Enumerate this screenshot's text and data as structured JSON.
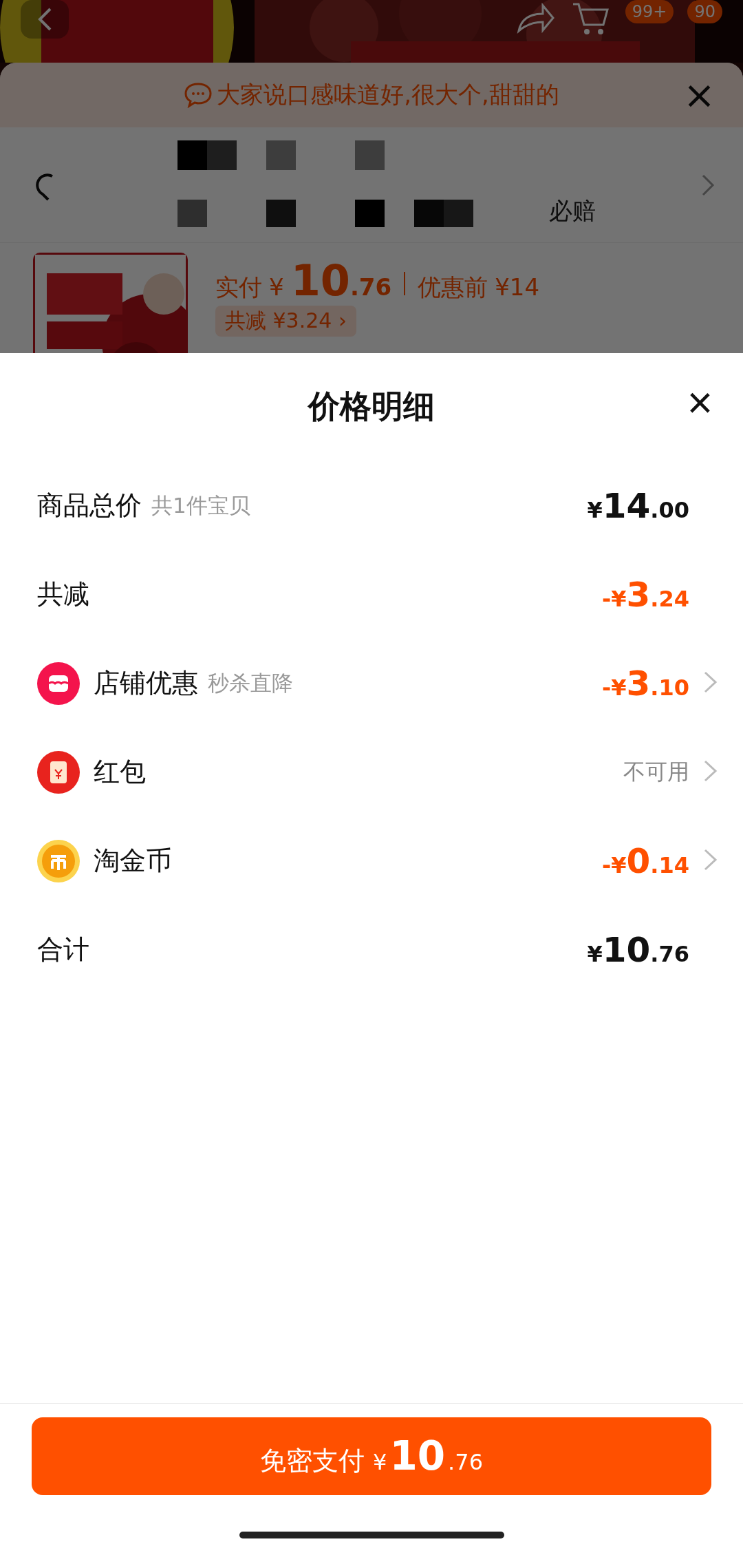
{
  "background_page": {
    "top_bar": {
      "cart_badge": "99+",
      "message_badge": "90"
    },
    "review_banner": {
      "text": "大家说口感味道好,很大个,甜甜的",
      "close": "×"
    },
    "address": {
      "note": "必赔"
    },
    "product": {
      "paid_label": "实付",
      "paid_symbol": "¥",
      "paid_int": "10",
      "paid_dec": ".76",
      "before_label": "优惠前",
      "before_price": "¥14",
      "discount_pill": "共减 ¥3.24 ›"
    }
  },
  "sheet": {
    "title": "价格明细",
    "close": "×",
    "rows": [
      {
        "kind": "plain",
        "label": "商品总价",
        "note": "共1件宝贝",
        "color": "#111111",
        "sign": "¥",
        "int": "14",
        "dec": ".00",
        "link": false
      },
      {
        "kind": "plain",
        "label": "共减",
        "color": "#ff5000",
        "sign": "-¥",
        "int": "3",
        "dec": ".24",
        "link": false
      },
      {
        "kind": "shop",
        "label": "店铺优惠",
        "note": "秒杀直降",
        "color": "#ff5000",
        "sign": "-¥",
        "int": "3",
        "dec": ".10",
        "link": true
      },
      {
        "kind": "redpacket",
        "label": "红包",
        "color": "#888888",
        "value": "不可用",
        "link": true
      },
      {
        "kind": "coin",
        "label": "淘金币",
        "color": "#ff5000",
        "sign": "-¥",
        "int": "0",
        "dec": ".14",
        "link": true
      },
      {
        "kind": "plain",
        "label": "合计",
        "color": "#111111",
        "sign": "¥",
        "int": "10",
        "dec": ".76",
        "link": false
      }
    ],
    "pay_button": {
      "label": "免密支付",
      "sign": "¥",
      "int": "10",
      "dec": ".76"
    }
  }
}
